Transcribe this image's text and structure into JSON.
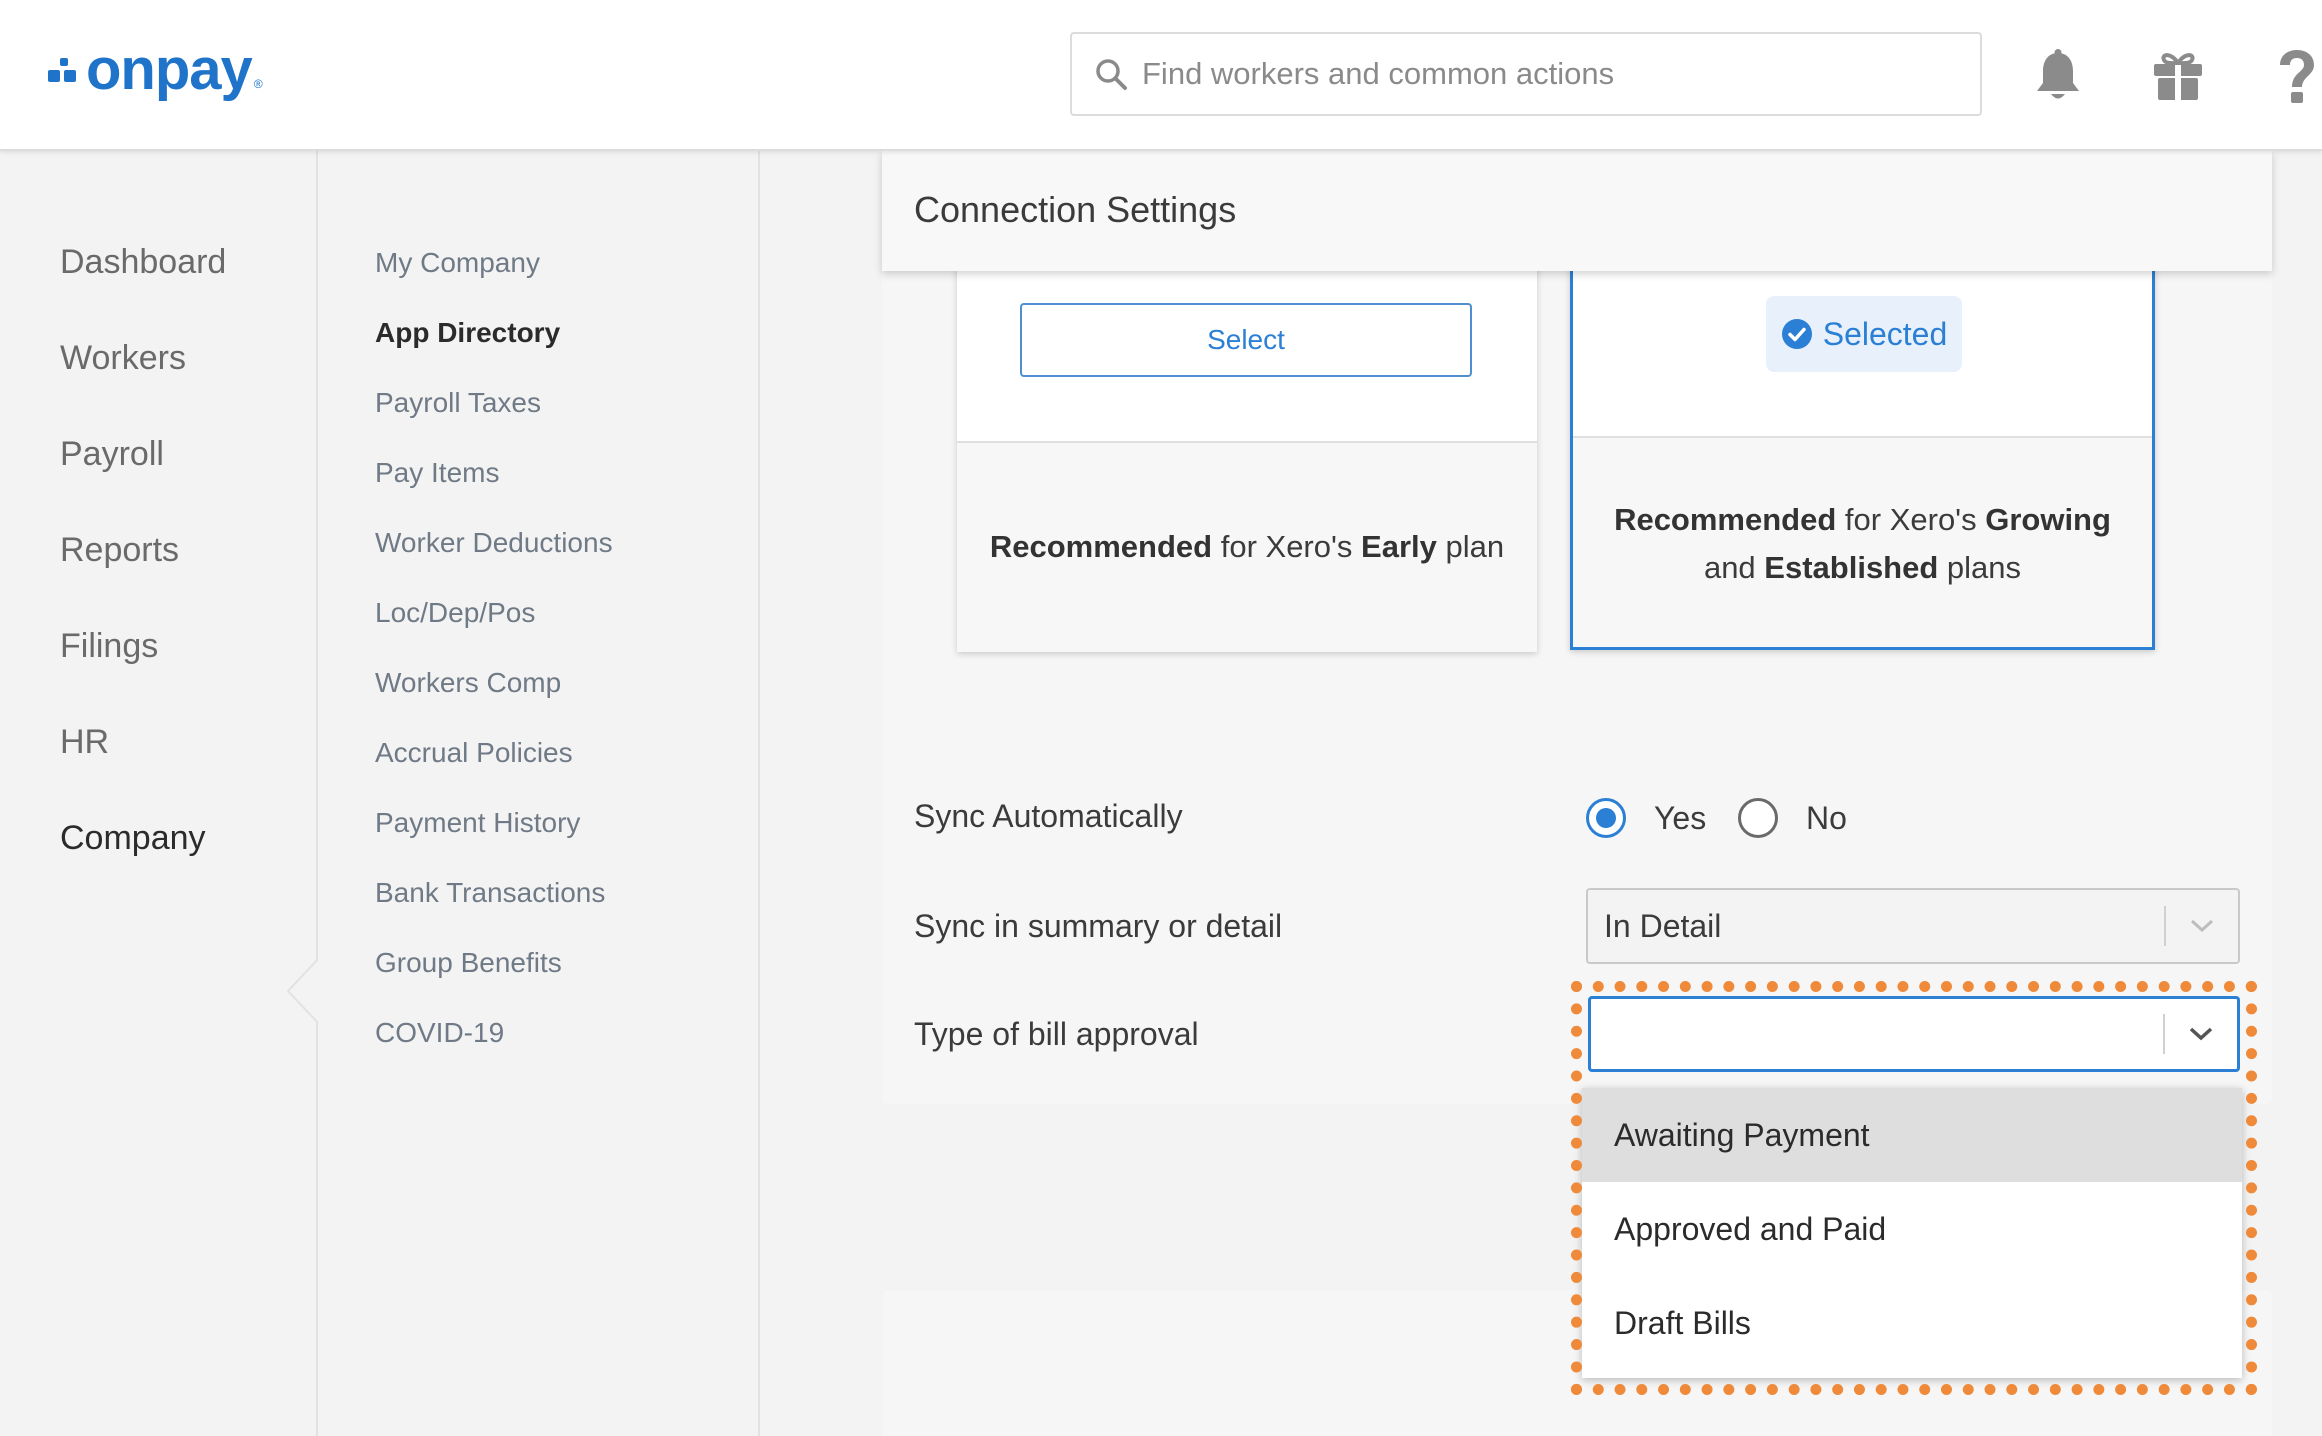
{
  "app": {
    "logo_text": "onpay",
    "logo_reg": "®",
    "brand_color": "#1f73c9"
  },
  "header": {
    "search_placeholder": "Find workers and common actions",
    "icons": [
      "bell-icon",
      "gift-icon",
      "help-icon"
    ]
  },
  "primary_nav": {
    "items": [
      {
        "label": "Dashboard"
      },
      {
        "label": "Workers"
      },
      {
        "label": "Payroll"
      },
      {
        "label": "Reports"
      },
      {
        "label": "Filings"
      },
      {
        "label": "HR"
      },
      {
        "label": "Company"
      }
    ],
    "active": "Company"
  },
  "secondary_nav": {
    "items": [
      {
        "label": "My Company"
      },
      {
        "label": "App Directory"
      },
      {
        "label": "Payroll Taxes"
      },
      {
        "label": "Pay Items"
      },
      {
        "label": "Worker Deductions"
      },
      {
        "label": "Loc/Dep/Pos"
      },
      {
        "label": "Workers Comp"
      },
      {
        "label": "Accrual Policies"
      },
      {
        "label": "Payment History"
      },
      {
        "label": "Bank Transactions"
      },
      {
        "label": "Group Benefits"
      },
      {
        "label": "COVID-19"
      }
    ],
    "active": "App Directory"
  },
  "connection": {
    "title": "Connection Settings",
    "plans": [
      {
        "button_label": "Select",
        "desc_bold1": "Recommended",
        "desc_mid": " for Xero's ",
        "desc_bold2": "Early",
        "desc_end": " plan"
      },
      {
        "badge_label": "Selected",
        "desc_bold1": "Recommended",
        "desc_mid": " for Xero's ",
        "desc_bold2": "Growing",
        "desc_line2_start": "and ",
        "desc_bold3": "Established",
        "desc_end": " plans"
      }
    ],
    "sync_auto": {
      "label": "Sync Automatically",
      "yes": "Yes",
      "no": "No",
      "selected": "Yes"
    },
    "sync_detail": {
      "label": "Sync in summary or detail",
      "value": "In Detail"
    },
    "bill_approval": {
      "label": "Type of bill approval",
      "value": "",
      "options": [
        "Awaiting Payment",
        "Approved and Paid",
        "Draft Bills"
      ],
      "highlighted": "Awaiting Payment"
    }
  },
  "colors": {
    "accent": "#2b7fd4",
    "highlight_outline": "#ee8a3a"
  }
}
